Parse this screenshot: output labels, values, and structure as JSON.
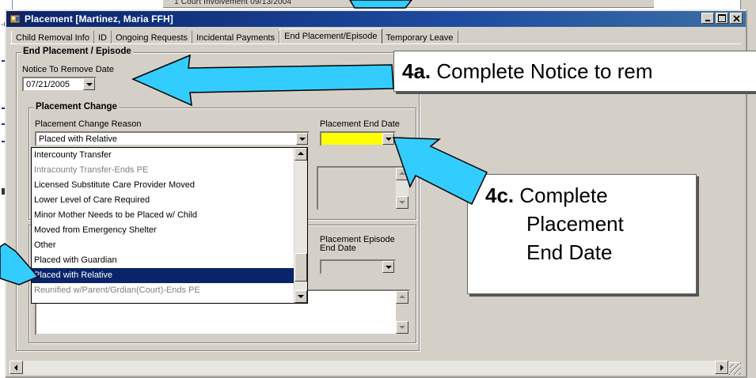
{
  "window": {
    "title": "Placement [Martinez, Maria FFH]",
    "controls": [
      "minimize",
      "maximize",
      "close"
    ]
  },
  "background": {
    "top_row_text": "1   Court Involvement   09/13/2004",
    "left_marks_text": "-6"
  },
  "tabs": [
    {
      "label": "Child Removal Info",
      "active": false
    },
    {
      "label": "ID",
      "active": false
    },
    {
      "label": "Ongoing Requests",
      "active": false
    },
    {
      "label": "Incidental Payments",
      "active": false
    },
    {
      "label": "End Placement/Episode",
      "active": true
    },
    {
      "label": "Temporary Leave",
      "active": false
    }
  ],
  "end_placement": {
    "group_title": "End Placement / Episode",
    "notice_label": "Notice To Remove Date",
    "notice_value": "07/21/2005"
  },
  "placement_change": {
    "group_title": "Placement Change",
    "reason_label": "Placement Change Reason",
    "reason_value": "Placed with Relative",
    "end_date_label": "Placement End Date",
    "end_date_value": ""
  },
  "reason_options": [
    {
      "label": "Intercounty Transfer",
      "disabled": false,
      "selected": false
    },
    {
      "label": "Intracounty Transfer-Ends PE",
      "disabled": true,
      "selected": false
    },
    {
      "label": "Licensed Substitute Care Provider Moved",
      "disabled": false,
      "selected": false
    },
    {
      "label": "Lower Level of Care Required",
      "disabled": false,
      "selected": false
    },
    {
      "label": "Minor Mother Needs to be Placed w/ Child",
      "disabled": false,
      "selected": false
    },
    {
      "label": "Moved from Emergency Shelter",
      "disabled": false,
      "selected": false
    },
    {
      "label": "Other",
      "disabled": false,
      "selected": false
    },
    {
      "label": "Placed with Guardian",
      "disabled": false,
      "selected": false
    },
    {
      "label": "Placed with Relative",
      "disabled": false,
      "selected": true
    },
    {
      "label": "Reunified w/Parent/Grdian(Court)-Ends PE",
      "disabled": true,
      "selected": false
    }
  ],
  "episode": {
    "end_date_label": "Placement Episode\nEnd Date",
    "end_date_value": ""
  },
  "callouts": {
    "c4a_num": "4a.",
    "c4a_text": "Complete Notice to rem",
    "c4c_num": "4c.",
    "c4c_line1": "Complete",
    "c4c_line2": "Placement",
    "c4c_line3": "End Date"
  },
  "colors": {
    "arrow_fill": "#33ccff",
    "arrow_stroke": "#000000",
    "title_bar": "#0a246a",
    "selected_item": "#0a246a",
    "required_field": "#ffff00",
    "window_face": "#d4d0c8"
  },
  "icons": {
    "app": "placement-app-icon",
    "dropdown": "chevron-down-icon",
    "scroll_up": "scroll-up-icon",
    "scroll_down": "scroll-down-icon"
  }
}
